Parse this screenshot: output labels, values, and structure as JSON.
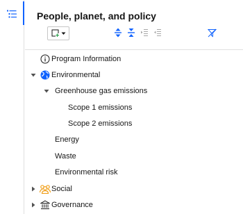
{
  "panel": {
    "title": "People, planet, and policy"
  },
  "colors": {
    "accent": "#0f62fe",
    "social_icon": "#f1a01c",
    "text": "#161616",
    "divider": "#e0e0e0"
  },
  "toolbar": {
    "icons": [
      "add-node-icon",
      "chevron-down-icon",
      "expand-all-icon",
      "collapse-all-icon",
      "indent-icon",
      "outdent-icon",
      "clear-filter-icon"
    ]
  },
  "tree": {
    "items": [
      {
        "label": "Program Information",
        "icon": "info-circle-icon",
        "caret": "none",
        "level": 0
      },
      {
        "label": "Environmental",
        "icon": "globe-icon",
        "caret": "expanded",
        "level": 0
      },
      {
        "label": "Greenhouse gas emissions",
        "icon": "none",
        "caret": "expanded",
        "level": 1
      },
      {
        "label": "Scope 1 emissions",
        "icon": "none",
        "caret": "none",
        "level": 2
      },
      {
        "label": "Scope 2 emissions",
        "icon": "none",
        "caret": "none",
        "level": 2
      },
      {
        "label": "Energy",
        "icon": "none",
        "caret": "none",
        "level": 1
      },
      {
        "label": "Waste",
        "icon": "none",
        "caret": "none",
        "level": 1
      },
      {
        "label": "Environmental risk",
        "icon": "none",
        "caret": "none",
        "level": 1
      },
      {
        "label": "Social",
        "icon": "people-icon",
        "caret": "collapsed",
        "level": 0
      },
      {
        "label": "Governance",
        "icon": "bank-icon",
        "caret": "collapsed",
        "level": 0
      }
    ]
  }
}
